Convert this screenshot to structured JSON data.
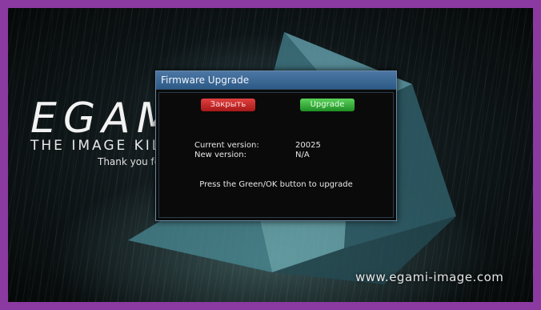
{
  "background": {
    "brand_title": "EGAMI",
    "brand_subtitle": "THE IMAGE KILLER",
    "brand_thanks": "Thank you for choosing",
    "website": "www.egami-image.com"
  },
  "dialog": {
    "title": "Firmware Upgrade",
    "close_button": "Закрыть",
    "upgrade_button": "Upgrade",
    "current_version_label": "Current version:",
    "current_version_value": "20025",
    "new_version_label": "New version:",
    "new_version_value": "N/A",
    "instruction": "Press the Green/OK button to upgrade"
  },
  "colors": {
    "frame": "#8a3aa0",
    "title_bar": "#3b6a98",
    "close_button": "#c62828",
    "upgrade_button": "#2ea42f"
  }
}
